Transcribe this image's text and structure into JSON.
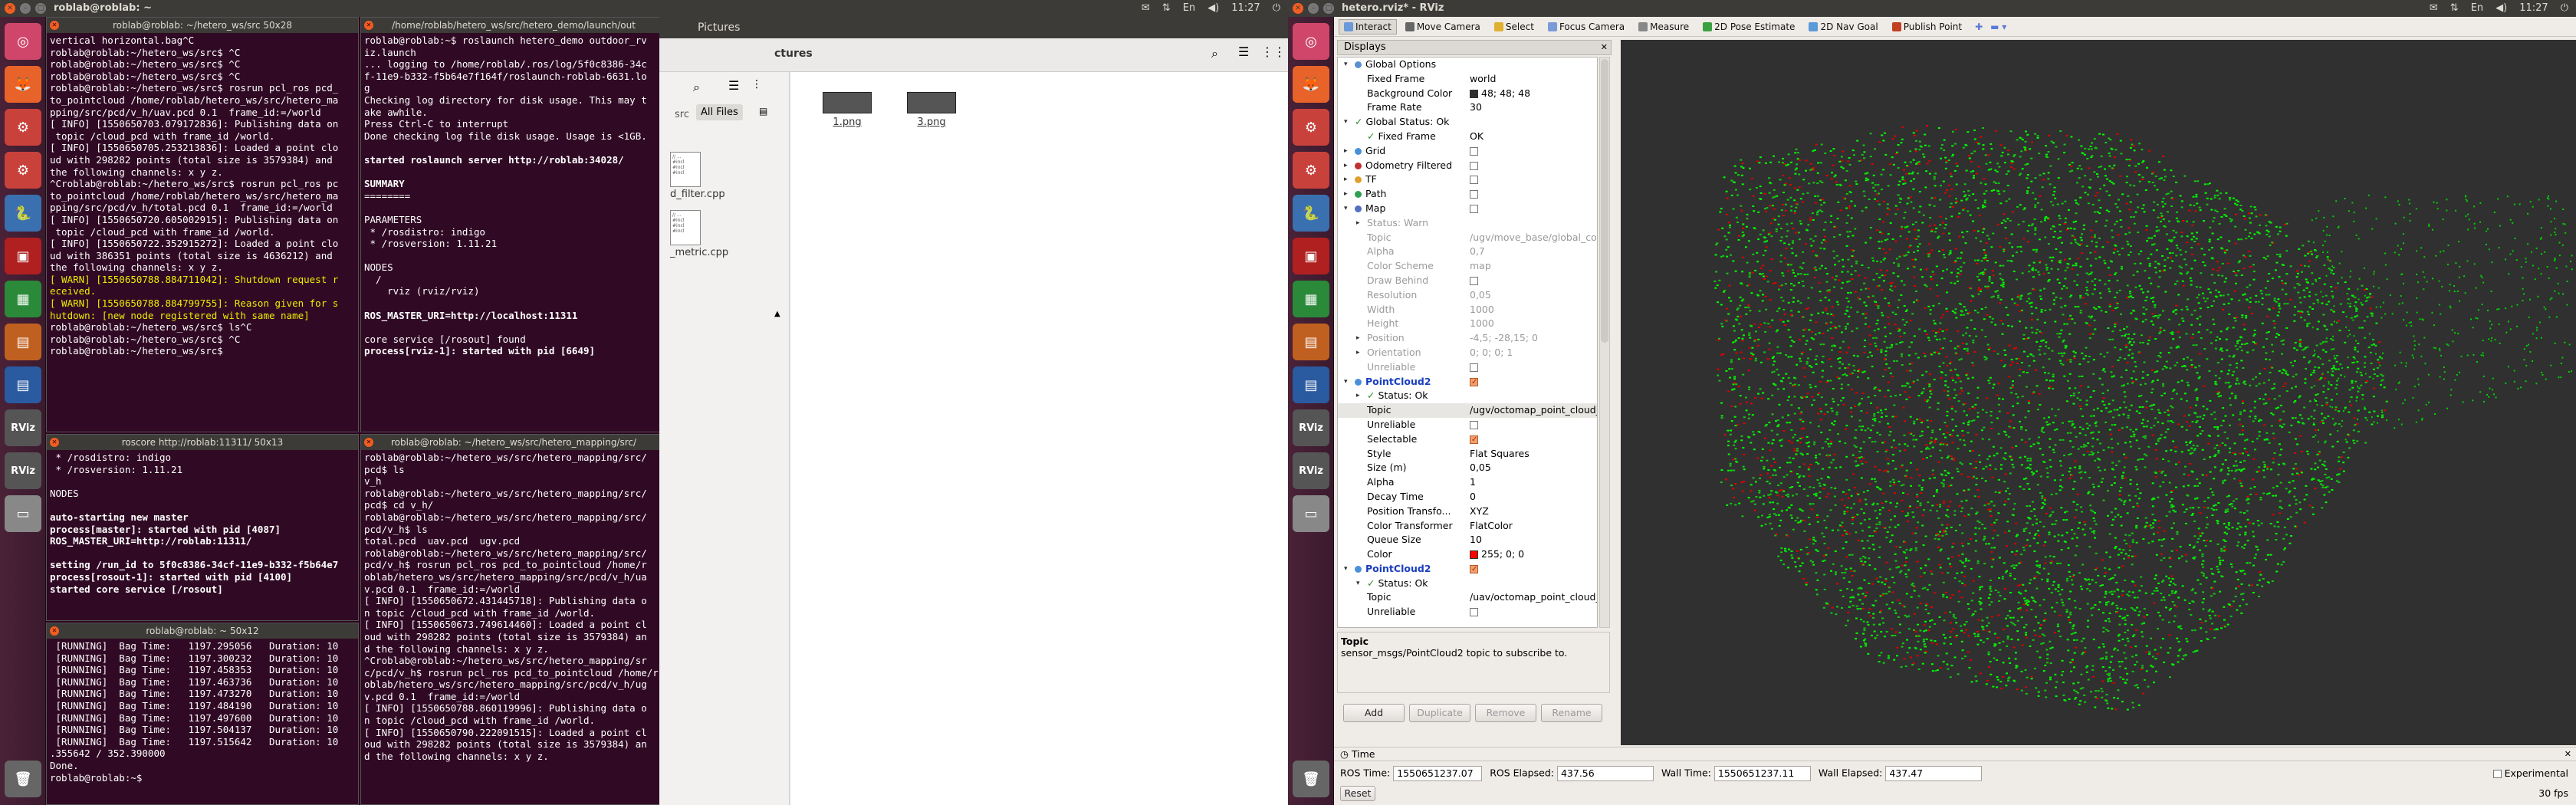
{
  "screen1": {
    "topbar": {
      "title": "roblab@roblab: ~",
      "time": "11:27"
    },
    "launcher_icons": [
      "dash-icon",
      "firefox-icon",
      "settings-icon",
      "gear2-icon",
      "python-icon",
      "rviz-red-icon",
      "calc-icon",
      "impress-icon",
      "writer-icon",
      "rviz-icon",
      "rviz-icon",
      "drive-icon",
      "trash-icon"
    ],
    "term1": {
      "title": "roblab@roblab: ~/hetero_ws/src 50x28",
      "lines": [
        "vertical horizontal.bag^C",
        "roblab@roblab:~/hetero_ws/src$ ^C",
        "roblab@roblab:~/hetero_ws/src$ ^C",
        "roblab@roblab:~/hetero_ws/src$ ^C",
        "roblab@roblab:~/hetero_ws/src$ rosrun pcl_ros pcd_",
        "to_pointcloud /home/roblab/hetero_ws/src/hetero_ma",
        "pping/src/pcd/v_h/uav.pcd 0.1  frame_id:=/world",
        "[ INFO] [1550650703.079172836]: Publishing data on",
        " topic /cloud_pcd with frame_id /world.",
        "[ INFO] [1550650705.253213836]: Loaded a point clo",
        "ud with 298282 points (total size is 3579384) and",
        "the following channels: x y z.",
        "^Croblab@roblab:~/hetero_ws/src$ rosrun pcl_ros pc",
        "to_pointcloud /home/roblab/hetero_ws/src/hetero_ma",
        "pping/src/pcd/v_h/total.pcd 0.1  frame_id:=/world",
        "[ INFO] [1550650720.605002915]: Publishing data on",
        " topic /cloud_pcd with frame_id /world.",
        "[ INFO] [1550650722.352915272]: Loaded a point clo",
        "ud with 386351 points (total size is 4636212) and",
        "the following channels: x y z.",
        "[ WARN] [1550650788.884711042]: Shutdown request r",
        "eceived.",
        "[ WARN] [1550650788.884799755]: Reason given for s",
        "hutdown: [new node registered with same name]",
        "roblab@roblab:~/hetero_ws/src$ ls^C",
        "roblab@roblab:~/hetero_ws/src$ ^C",
        "roblab@roblab:~/hetero_ws/src$ "
      ]
    },
    "term2": {
      "title": "/home/roblab/hetero_ws/src/hetero_demo/launch/out",
      "lines": [
        "roblab@roblab:~$ roslaunch hetero_demo outdoor_rv",
        "iz.launch",
        "... logging to /home/roblab/.ros/log/5f0c8386-34c",
        "f-11e9-b332-f5b64e7f164f/roslaunch-roblab-6631.lo",
        "g",
        "Checking log directory for disk usage. This may t",
        "ake awhile.",
        "Press Ctrl-C to interrupt",
        "Done checking log file disk usage. Usage is <1GB.",
        "",
        "started roslaunch server http://roblab:34028/",
        "",
        "SUMMARY",
        "========",
        "",
        "PARAMETERS",
        " * /rosdistro: indigo",
        " * /rosversion: 1.11.21",
        "",
        "NODES",
        "  /",
        "    rviz (rviz/rviz)",
        "",
        "ROS_MASTER_URI=http://localhost:11311",
        "",
        "core service [/rosout] found",
        "process[rviz-1]: started with pid [6649]"
      ]
    },
    "term3": {
      "title": "roscore http://roblab:11311/ 50x13",
      "lines": [
        " * /rosdistro: indigo",
        " * /rosversion: 1.11.21",
        "",
        "NODES",
        "",
        "auto-starting new master",
        "process[master]: started with pid [4087]",
        "ROS_MASTER_URI=http://roblab:11311/",
        "",
        "setting /run_id to 5f0c8386-34cf-11e9-b332-f5b64e7",
        "process[rosout-1]: started with pid [4100]",
        "started core service [/rosout]"
      ]
    },
    "term4": {
      "title": "roblab@roblab: ~/hetero_ws/src/hetero_mapping/src/",
      "lines": [
        "roblab@roblab:~/hetero_ws/src/hetero_mapping/src/",
        "pcd$ ls",
        "v_h",
        "roblab@roblab:~/hetero_ws/src/hetero_mapping/src/",
        "pcd$ cd v_h/",
        "roblab@roblab:~/hetero_ws/src/hetero_mapping/src/",
        "pcd/v_h$ ls",
        "total.pcd  uav.pcd  ugv.pcd",
        "roblab@roblab:~/hetero_ws/src/hetero_mapping/src/",
        "pcd/v_h$ rosrun pcl_ros pcd_to_pointcloud /home/r",
        "oblab/hetero_ws/src/hetero_mapping/src/pcd/v_h/ua",
        "v.pcd 0.1  frame_id:=/world",
        "[ INFO] [1550650672.431445718]: Publishing data o",
        "n topic /cloud_pcd with frame_id /world.",
        "[ INFO] [1550650673.749614460]: Loaded a point cl",
        "oud with 298282 points (total size is 3579384) an",
        "d the following channels: x y z.",
        "^Croblab@roblab:~/hetero_ws/src/hetero_mapping/sr",
        "c/pcd/v_h$ rosrun pcl_ros pcd_to_pointcloud /home/r",
        "oblab/hetero_ws/src/hetero_mapping/src/pcd/v_h/ug",
        "v.pcd 0.1  frame_id:=/world",
        "[ INFO] [1550650788.860119996]: Publishing data o",
        "n topic /cloud_pcd with frame_id /world.",
        "[ INFO] [1550650790.222091515]: Loaded a point cl",
        "oud with 298282 points (total size is 3579384) an",
        "d the following channels: x y z."
      ]
    },
    "term5": {
      "title": "roblab@roblab: ~ 50x12",
      "lines": [
        " [RUNNING]  Bag Time:   1197.295056   Duration: 10",
        " [RUNNING]  Bag Time:   1197.300232   Duration: 10",
        " [RUNNING]  Bag Time:   1197.458353   Duration: 10",
        " [RUNNING]  Bag Time:   1197.463736   Duration: 10",
        " [RUNNING]  Bag Time:   1197.473270   Duration: 10",
        " [RUNNING]  Bag Time:   1197.484190   Duration: 10",
        " [RUNNING]  Bag Time:   1197.497600   Duration: 10",
        " [RUNNING]  Bag Time:   1197.504137   Duration: 10",
        " [RUNNING]  Bag Time:   1197.515642   Duration: 10",
        ".355642 / 352.390000",
        "Done.",
        "roblab@roblab:~$ "
      ]
    },
    "files": {
      "title": "Pictures",
      "tab": "ctures",
      "side": "src",
      "all_files": "All Files",
      "items": [
        "1.png",
        "3.png"
      ],
      "side_files": [
        "d_filter.cpp",
        "_metric.cpp"
      ]
    }
  },
  "screen2": {
    "topbar": {
      "title": "hetero.rviz* - RViz",
      "time": "11:27"
    },
    "toolbar": [
      "Interact",
      "Move Camera",
      "Select",
      "Focus Camera",
      "Measure",
      "2D Pose Estimate",
      "2D Nav Goal",
      "Publish Point"
    ],
    "displays_title": "Displays",
    "rows": [
      {
        "k": "Global Options",
        "v": "",
        "lvl": 0,
        "exp": "▾",
        "ic": "#5b8fd0"
      },
      {
        "k": "Fixed Frame",
        "v": "world",
        "lvl": 1
      },
      {
        "k": "Background Color",
        "v": "48; 48; 48",
        "lvl": 1,
        "sw": "#303030"
      },
      {
        "k": "Frame Rate",
        "v": "30",
        "lvl": 1
      },
      {
        "k": "Global Status: Ok",
        "v": "",
        "lvl": 0,
        "exp": "▾",
        "ok": true
      },
      {
        "k": "Fixed Frame",
        "v": "OK",
        "lvl": 1,
        "ok": true
      },
      {
        "k": "Grid",
        "v": "",
        "lvl": 0,
        "exp": "▸",
        "ic": "#4a90d9",
        "cb": "off"
      },
      {
        "k": "Odometry Filtered",
        "v": "",
        "lvl": 0,
        "exp": "▸",
        "ic": "#c03030",
        "cb": "off"
      },
      {
        "k": "TF",
        "v": "",
        "lvl": 0,
        "exp": "▸",
        "ic": "#e0a030",
        "cb": "off"
      },
      {
        "k": "Path",
        "v": "",
        "lvl": 0,
        "exp": "▸",
        "ic": "#30a050",
        "cb": "off"
      },
      {
        "k": "Map",
        "v": "",
        "lvl": 0,
        "exp": "▾",
        "ic": "#5070c0",
        "cb": "off"
      },
      {
        "k": "Status: Warn",
        "v": "",
        "lvl": 1,
        "exp": "▸",
        "dim": true
      },
      {
        "k": "Topic",
        "v": "/ugv/move_base/global_costmap/costmap",
        "lvl": 1,
        "dim": true
      },
      {
        "k": "Alpha",
        "v": "0,7",
        "lvl": 1,
        "dim": true
      },
      {
        "k": "Color Scheme",
        "v": "map",
        "lvl": 1,
        "dim": true
      },
      {
        "k": "Draw Behind",
        "v": "",
        "lvl": 1,
        "dim": true,
        "cb": "off"
      },
      {
        "k": "Resolution",
        "v": "0,05",
        "lvl": 1,
        "dim": true
      },
      {
        "k": "Width",
        "v": "1000",
        "lvl": 1,
        "dim": true
      },
      {
        "k": "Height",
        "v": "1000",
        "lvl": 1,
        "dim": true
      },
      {
        "k": "Position",
        "v": "-4,5; -28,15; 0",
        "lvl": 1,
        "exp": "▸",
        "dim": true
      },
      {
        "k": "Orientation",
        "v": "0; 0; 0; 1",
        "lvl": 1,
        "exp": "▸",
        "dim": true
      },
      {
        "k": "Unreliable",
        "v": "",
        "lvl": 1,
        "dim": true,
        "cb": "off"
      },
      {
        "k": "PointCloud2",
        "v": "",
        "lvl": 0,
        "exp": "▾",
        "ic": "#4a90d9",
        "cb": "on",
        "blue": true
      },
      {
        "k": "Status: Ok",
        "v": "",
        "lvl": 1,
        "exp": "▸",
        "ok": true
      },
      {
        "k": "Topic",
        "v": "/ugv/octomap_point_cloud_centers",
        "lvl": 1,
        "hl": true
      },
      {
        "k": "Unreliable",
        "v": "",
        "lvl": 1,
        "cb": "off"
      },
      {
        "k": "Selectable",
        "v": "",
        "lvl": 1,
        "cb": "on"
      },
      {
        "k": "Style",
        "v": "Flat Squares",
        "lvl": 1
      },
      {
        "k": "Size (m)",
        "v": "0,05",
        "lvl": 1
      },
      {
        "k": "Alpha",
        "v": "1",
        "lvl": 1
      },
      {
        "k": "Decay Time",
        "v": "0",
        "lvl": 1
      },
      {
        "k": "Position Transfo...",
        "v": "XYZ",
        "lvl": 1
      },
      {
        "k": "Color Transformer",
        "v": "FlatColor",
        "lvl": 1
      },
      {
        "k": "Queue Size",
        "v": "10",
        "lvl": 1
      },
      {
        "k": "Color",
        "v": "255; 0; 0",
        "lvl": 1,
        "sw": "#ff0000"
      },
      {
        "k": "PointCloud2",
        "v": "",
        "lvl": 0,
        "exp": "▾",
        "ic": "#4a90d9",
        "cb": "on",
        "blue": true
      },
      {
        "k": "Status: Ok",
        "v": "",
        "lvl": 1,
        "exp": "▾",
        "ok": true
      },
      {
        "k": "Topic",
        "v": "/uav/octomap_point_cloud_centers",
        "lvl": 1
      },
      {
        "k": "Unreliable",
        "v": "",
        "lvl": 1,
        "cb": "off"
      }
    ],
    "desc": {
      "title": "Topic",
      "text": "sensor_msgs/PointCloud2 topic to subscribe to."
    },
    "buttons": {
      "add": "Add",
      "duplicate": "Duplicate",
      "remove": "Remove",
      "rename": "Rename"
    },
    "time": {
      "title": "Time",
      "ros_time_label": "ROS Time:",
      "ros_time": "1550651237.07",
      "ros_elapsed_label": "ROS Elapsed:",
      "ros_elapsed": "437.56",
      "wall_time_label": "Wall Time:",
      "wall_time": "1550651237.11",
      "wall_elapsed_label": "Wall Elapsed:",
      "wall_elapsed": "437.47",
      "experimental": "Experimental",
      "reset": "Reset",
      "fps": "30 fps"
    },
    "cloud_colors": {
      "ugv": "#ff0000",
      "uav": "#00ff00"
    }
  }
}
